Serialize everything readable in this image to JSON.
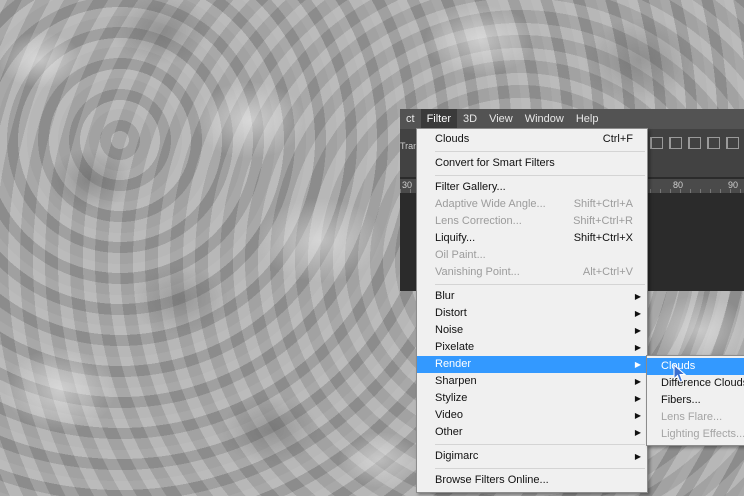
{
  "menubar": {
    "items": [
      "ct",
      "Filter",
      "3D",
      "View",
      "Window",
      "Help"
    ],
    "active_index": 1
  },
  "options_bar": {
    "fragment_label": "Tran"
  },
  "ruler": {
    "ticks": [
      "30",
      "80",
      "90"
    ]
  },
  "filter_menu": {
    "last_filter": {
      "label": "Clouds",
      "shortcut": "Ctrl+F"
    },
    "convert_smart": {
      "label": "Convert for Smart Filters"
    },
    "filter_gallery": {
      "label": "Filter Gallery..."
    },
    "adaptive_wide": {
      "label": "Adaptive Wide Angle...",
      "shortcut": "Shift+Ctrl+A"
    },
    "lens_correction": {
      "label": "Lens Correction...",
      "shortcut": "Shift+Ctrl+R"
    },
    "liquify": {
      "label": "Liquify...",
      "shortcut": "Shift+Ctrl+X"
    },
    "oil_paint": {
      "label": "Oil Paint..."
    },
    "vanishing_point": {
      "label": "Vanishing Point...",
      "shortcut": "Alt+Ctrl+V"
    },
    "blur": {
      "label": "Blur"
    },
    "distort": {
      "label": "Distort"
    },
    "noise": {
      "label": "Noise"
    },
    "pixelate": {
      "label": "Pixelate"
    },
    "render": {
      "label": "Render"
    },
    "sharpen": {
      "label": "Sharpen"
    },
    "stylize": {
      "label": "Stylize"
    },
    "video": {
      "label": "Video"
    },
    "other": {
      "label": "Other"
    },
    "digimarc": {
      "label": "Digimarc"
    },
    "browse_online": {
      "label": "Browse Filters Online..."
    },
    "arrow_glyph": "▶"
  },
  "render_submenu": {
    "clouds": "Clouds",
    "difference_clouds": "Difference Clouds",
    "fibers": "Fibers...",
    "lens_flare": "Lens Flare...",
    "lighting_effects": "Lighting Effects..."
  },
  "colors": {
    "highlight": "#3399ff",
    "menu_bg": "#f0f0f0",
    "chrome": "#535353"
  }
}
